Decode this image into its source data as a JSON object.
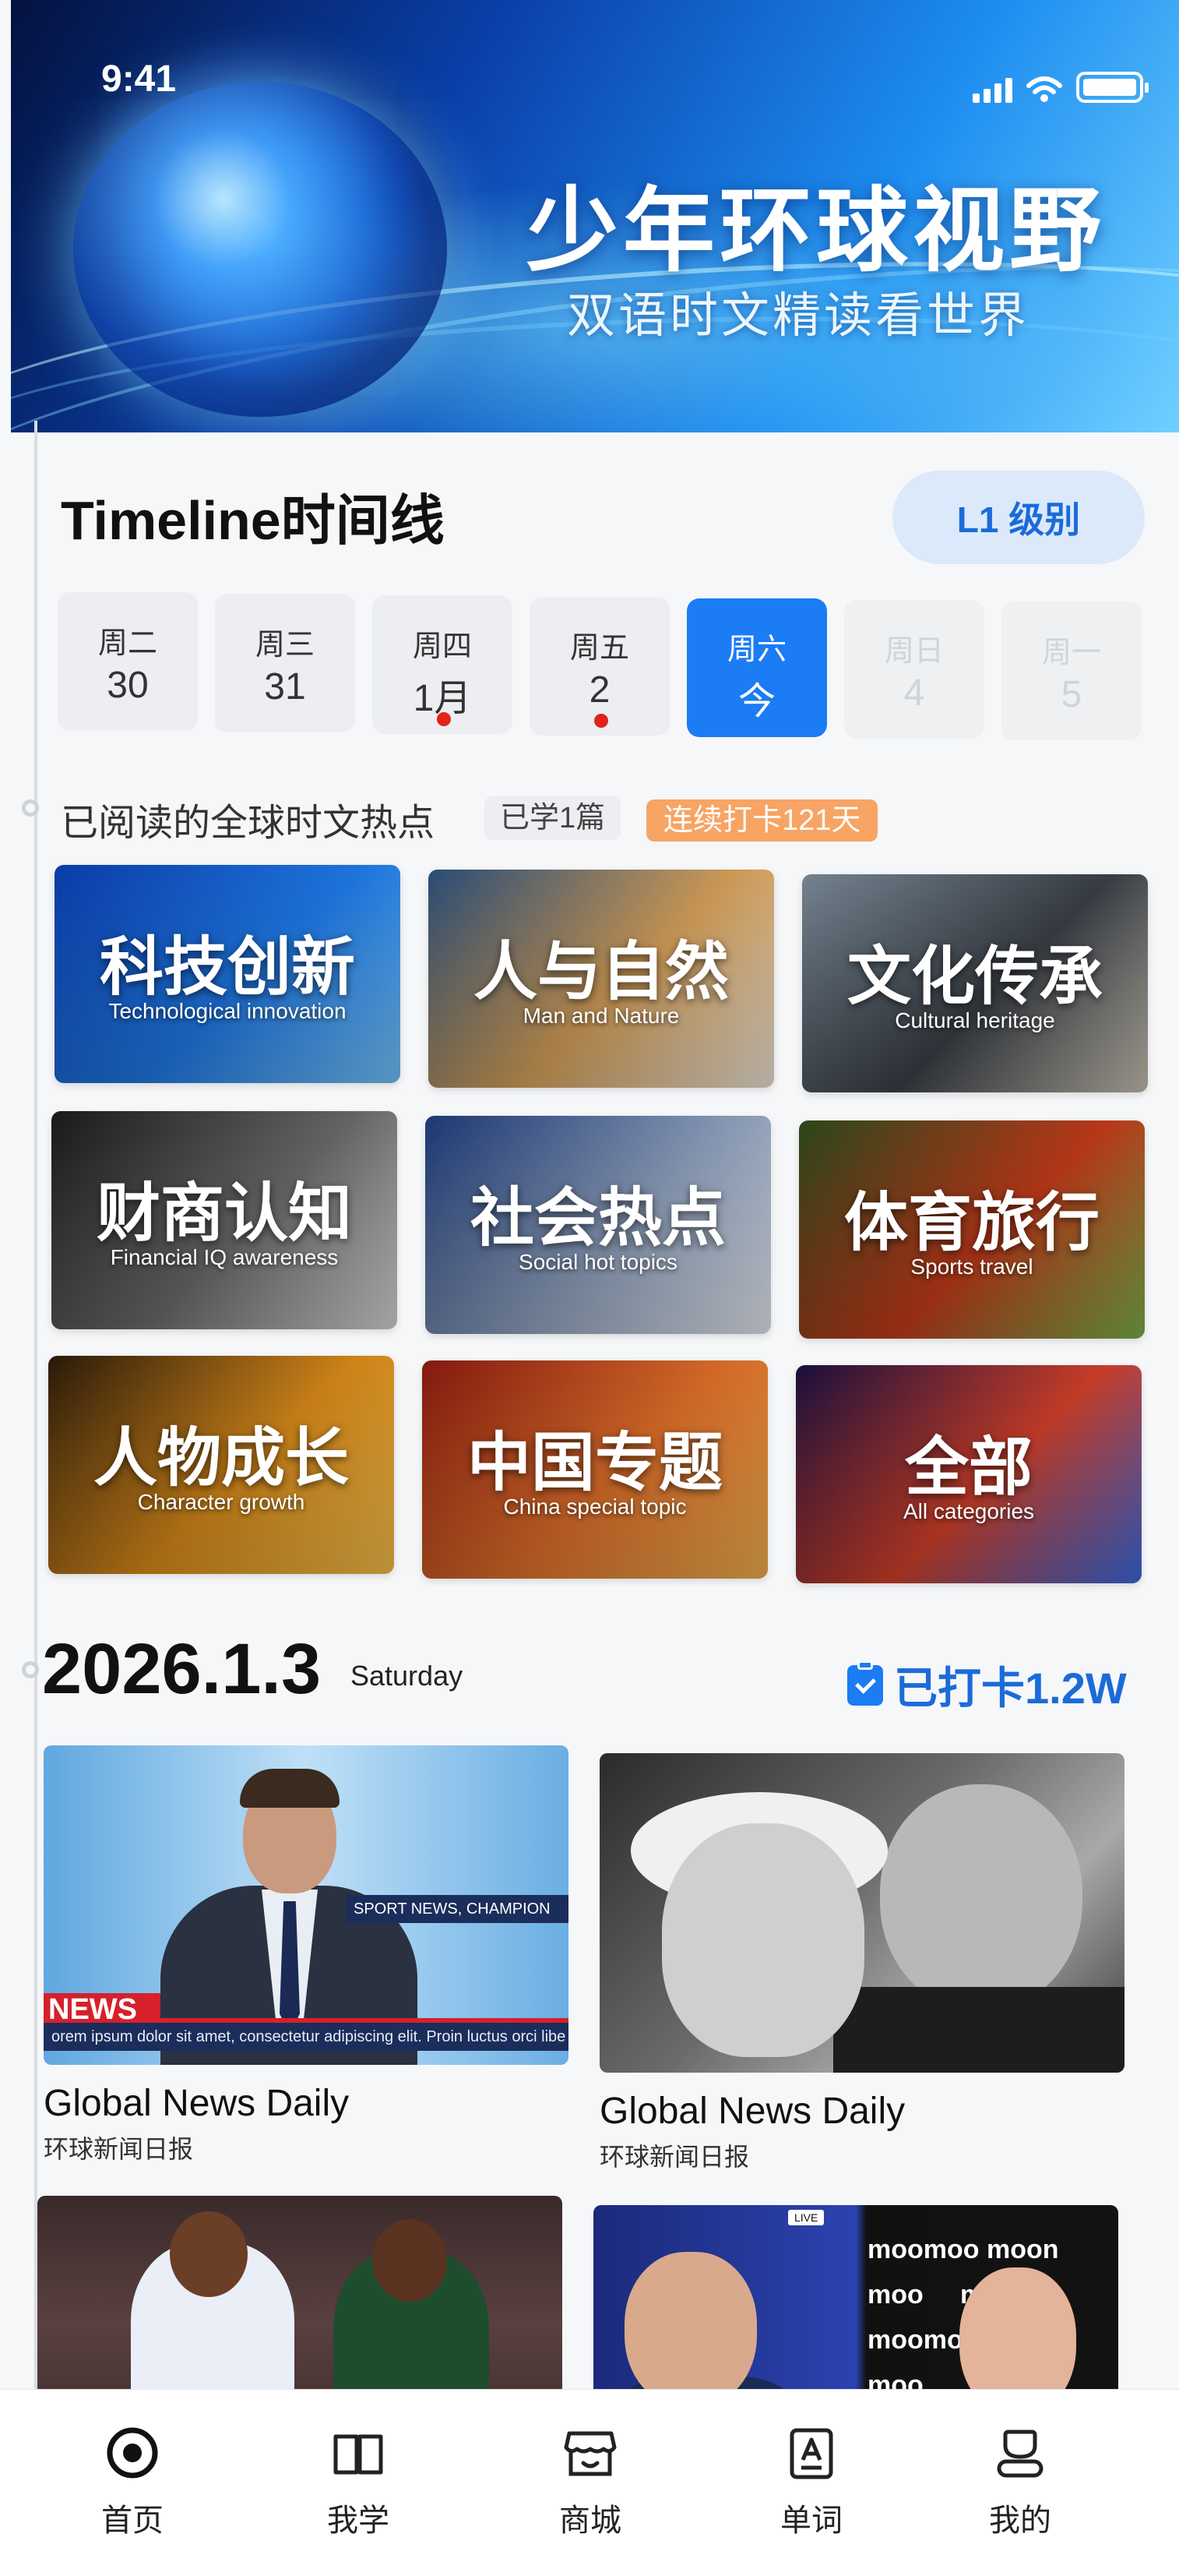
{
  "status_bar": {
    "time": "9:41"
  },
  "hero": {
    "title": "少年环球视野",
    "subtitle": "双语时文精读看世界"
  },
  "timeline": {
    "heading": "Timeline时间线",
    "level_button": "L1 级别",
    "days": [
      {
        "weekday": "周二",
        "date": "30",
        "dot": false,
        "state": "past"
      },
      {
        "weekday": "周三",
        "date": "31",
        "dot": false,
        "state": "past"
      },
      {
        "weekday": "周四",
        "date": "1月",
        "dot": true,
        "state": "past"
      },
      {
        "weekday": "周五",
        "date": "2",
        "dot": true,
        "state": "past"
      },
      {
        "weekday": "周六",
        "date": "今",
        "dot": false,
        "state": "active"
      },
      {
        "weekday": "周日",
        "date": "4",
        "dot": false,
        "state": "future"
      },
      {
        "weekday": "周一",
        "date": "5",
        "dot": false,
        "state": "future"
      }
    ]
  },
  "read_section": {
    "title": "已阅读的全球时文热点",
    "learned_badge": "已学1篇",
    "streak_badge": "连续打卡121天"
  },
  "categories": [
    {
      "zh": "科技创新",
      "en": "Technological innovation",
      "colors": [
        "#0b3fb0",
        "#1f7ae8",
        "#74c6ff"
      ]
    },
    {
      "zh": "人与自然",
      "en": "Man and Nature",
      "colors": [
        "#2a4f7c",
        "#d8a25a",
        "#f0e6d8"
      ]
    },
    {
      "zh": "文化传承",
      "en": "Cultural heritage",
      "colors": [
        "#7a8a98",
        "#3a3f46",
        "#c9c3b6"
      ]
    },
    {
      "zh": "财商认知",
      "en": "Financial IQ awareness",
      "colors": [
        "#1a1a1a",
        "#6b6b6b",
        "#d8d8d8"
      ]
    },
    {
      "zh": "社会热点",
      "en": "Social hot topics",
      "colors": [
        "#1d3a78",
        "#8ea0bd",
        "#e6eaf2"
      ]
    },
    {
      "zh": "体育旅行",
      "en": "Sports travel",
      "colors": [
        "#2c4a1c",
        "#c23a1a",
        "#7ab04a"
      ]
    },
    {
      "zh": "人物成长",
      "en": "Character growth",
      "colors": [
        "#2a1a0a",
        "#d98a1a",
        "#f6c04a"
      ]
    },
    {
      "zh": "中国专题",
      "en": "China special topic",
      "colors": [
        "#8a1a10",
        "#e0702a",
        "#f2b050"
      ]
    },
    {
      "zh": "全部",
      "en": "All categories",
      "colors": [
        "#1a1040",
        "#d1402a",
        "#3a6ae0"
      ]
    }
  ],
  "date_section": {
    "date": "2026.1.3",
    "weekday": "Saturday",
    "checkin": "已打卡1.2W"
  },
  "news": [
    {
      "title": "Global News Daily",
      "subtitle": "环球新闻日报",
      "thumb": {
        "tag": "NEWS",
        "ticker_top": "SPORT NEWS, CHAMPION",
        "ticker": "orem ipsum dolor sit amet, consectetur adipiscing elit. Proin luctus orci libe"
      }
    },
    {
      "title": "Global News Daily",
      "subtitle": "环球新闻日报"
    },
    {
      "title": "",
      "subtitle": ""
    },
    {
      "title": "",
      "subtitle": "",
      "thumb": {
        "live": "LIVE",
        "moo_text": "moomoo moon\nmoo     moo\nmoomoo moon\nmoo"
      }
    }
  ],
  "tabbar": [
    {
      "label": "首页",
      "icon": "home-target-icon",
      "active": true
    },
    {
      "label": "我学",
      "icon": "book-icon",
      "active": false
    },
    {
      "label": "商城",
      "icon": "store-icon",
      "active": false
    },
    {
      "label": "单词",
      "icon": "word-card-icon",
      "active": false
    },
    {
      "label": "我的",
      "icon": "user-icon",
      "active": false
    }
  ]
}
